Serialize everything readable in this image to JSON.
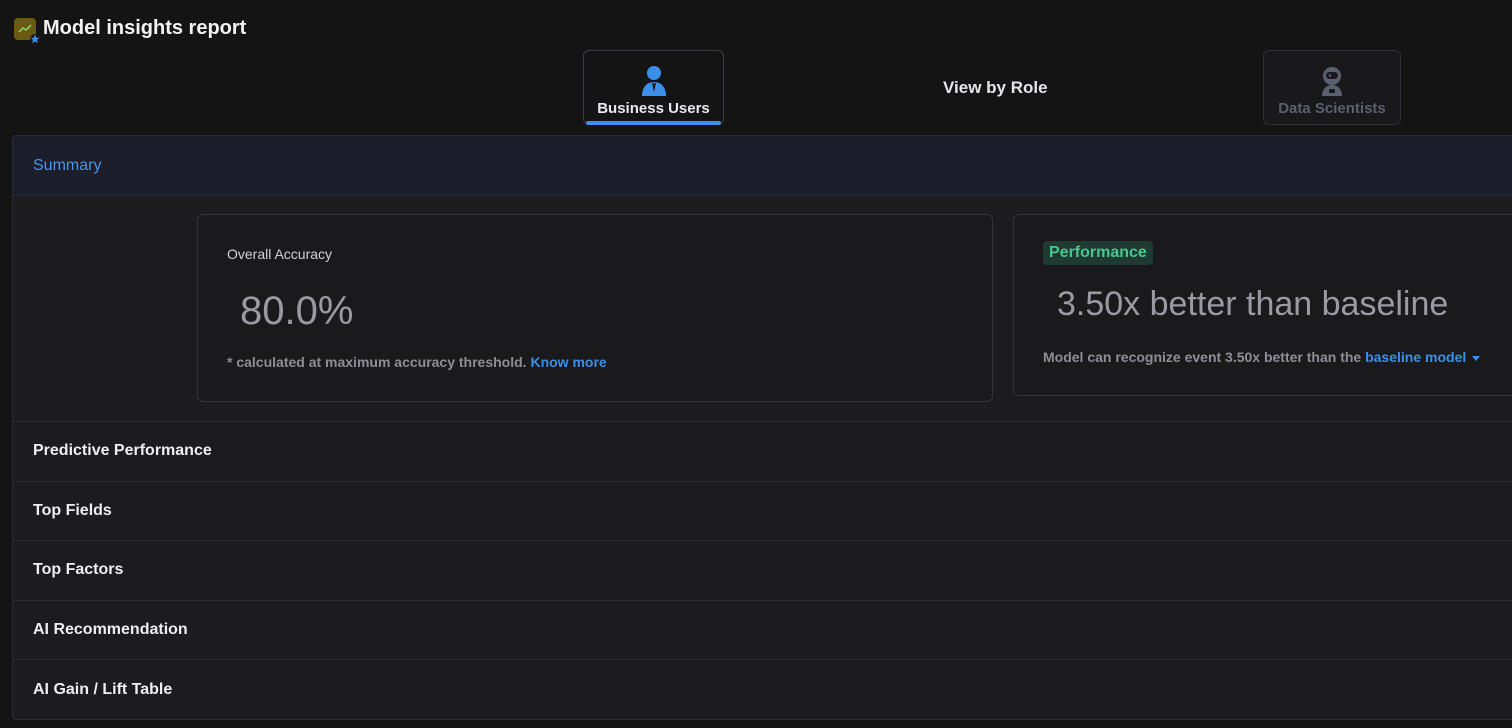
{
  "header": {
    "title": "Model insights report",
    "logo_icon": "trend-chart-icon"
  },
  "roles": {
    "center_label": "View by Role",
    "business": {
      "label": "Business Users",
      "icon": "business-user-icon",
      "active": true
    },
    "scientist": {
      "label": "Data Scientists",
      "icon": "astronaut-icon",
      "active": false
    }
  },
  "summary": {
    "title": "Summary",
    "accuracy": {
      "label": "Overall Accuracy",
      "value": "80.0%",
      "note": "* calculated at maximum accuracy threshold.",
      "link": "Know more"
    },
    "performance": {
      "badge": "Performance",
      "value": "3.50x better than baseline",
      "note": "Model can recognize event 3.50x better than the",
      "link": "baseline model"
    }
  },
  "sections": [
    "Predictive Performance",
    "Top Fields",
    "Top Factors",
    "AI Recommendation",
    "AI Gain / Lift Table"
  ],
  "colors": {
    "accent": "#3b8fe8",
    "success": "#49c58d",
    "background": "#141414"
  }
}
